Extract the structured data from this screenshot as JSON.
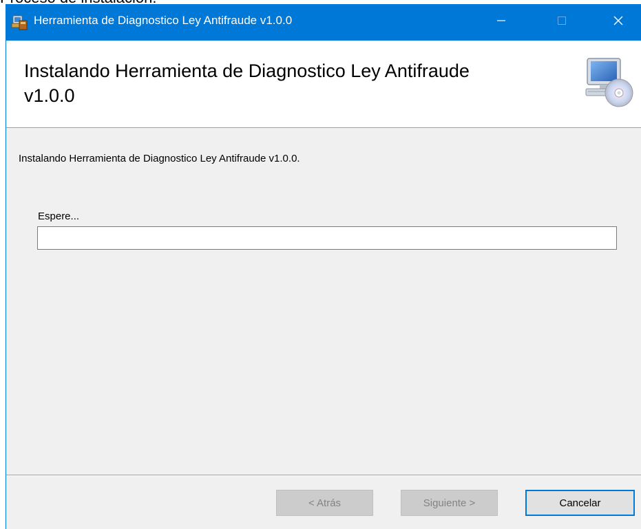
{
  "cut_caption": "Proceso de instalación.",
  "window": {
    "title": "Herramienta de Diagnostico Ley Antifraude v1.0.0",
    "controls": {
      "minimize_icon": "minimize-icon",
      "maximize_icon": "maximize-icon",
      "close_icon": "close-icon"
    }
  },
  "header": {
    "title": "Instalando Herramienta de Diagnostico Ley Antifraude v1.0.0",
    "image_icon": "computer-cd-icon"
  },
  "main": {
    "description": "Instalando Herramienta de Diagnostico Ley Antifraude v1.0.0.",
    "wait_label": "Espere...",
    "progress_fraction": 0.0
  },
  "buttons": {
    "back_label": "< Atrás",
    "next_label": "Siguiente >",
    "cancel_label": "Cancelar"
  },
  "colors": {
    "titlebar": "#0078d7",
    "focus_border": "#0078d7",
    "progress_fill": "#06b025"
  }
}
